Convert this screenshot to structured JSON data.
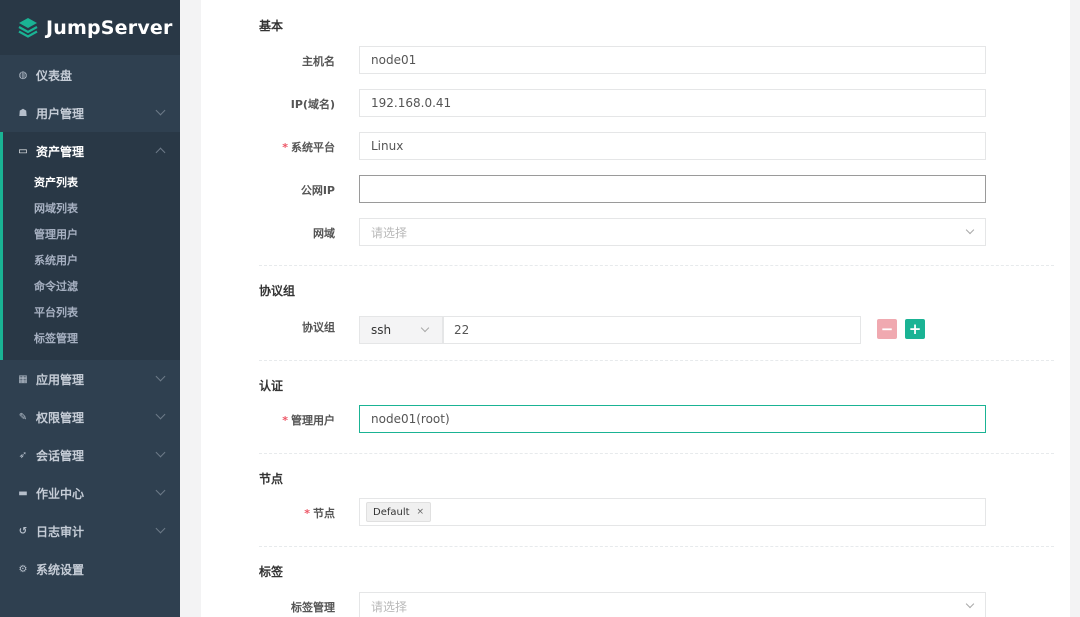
{
  "app": {
    "brand": "JumpServer"
  },
  "sidebar": {
    "items": [
      {
        "label": "仪表盘",
        "icon": "dashboard-icon"
      },
      {
        "label": "用户管理",
        "icon": "users-icon"
      },
      {
        "label": "资产管理",
        "icon": "inbox-icon",
        "expanded": true,
        "children": [
          "资产列表",
          "网域列表",
          "管理用户",
          "系统用户",
          "命令过滤",
          "平台列表",
          "标签管理"
        ],
        "current_child": "资产列表"
      },
      {
        "label": "应用管理",
        "icon": "grid-icon"
      },
      {
        "label": "权限管理",
        "icon": "edit-icon"
      },
      {
        "label": "会话管理",
        "icon": "rocket-icon"
      },
      {
        "label": "作业中心",
        "icon": "desktop-icon"
      },
      {
        "label": "日志审计",
        "icon": "history-icon"
      },
      {
        "label": "系统设置",
        "icon": "gears-icon"
      }
    ]
  },
  "form": {
    "basic": {
      "title": "基本",
      "hostname": {
        "label": "主机名",
        "value": "node01"
      },
      "ip": {
        "label": "IP(域名)",
        "value": "192.168.0.41"
      },
      "platform": {
        "label": "系统平台",
        "value": "Linux",
        "required": true
      },
      "public_ip": {
        "label": "公网IP",
        "value": ""
      },
      "domain": {
        "label": "网域",
        "placeholder": "请选择"
      }
    },
    "protocols": {
      "title": "协议组",
      "label": "协议组",
      "protocol": "ssh",
      "port": "22",
      "remove_label": "−",
      "add_label": "+"
    },
    "auth": {
      "title": "认证",
      "admin_user": {
        "label": "管理用户",
        "value": "node01(root)",
        "required": true
      }
    },
    "nodes": {
      "title": "节点",
      "label": "节点",
      "required": true,
      "tags": [
        "Default"
      ],
      "tag_remove": "×"
    },
    "labels": {
      "title": "标签",
      "label": "标签管理",
      "placeholder": "请选择"
    }
  },
  "colors": {
    "sidebar_bg": "#2f4050",
    "accent": "#1ab394",
    "danger": "#ed5565"
  }
}
